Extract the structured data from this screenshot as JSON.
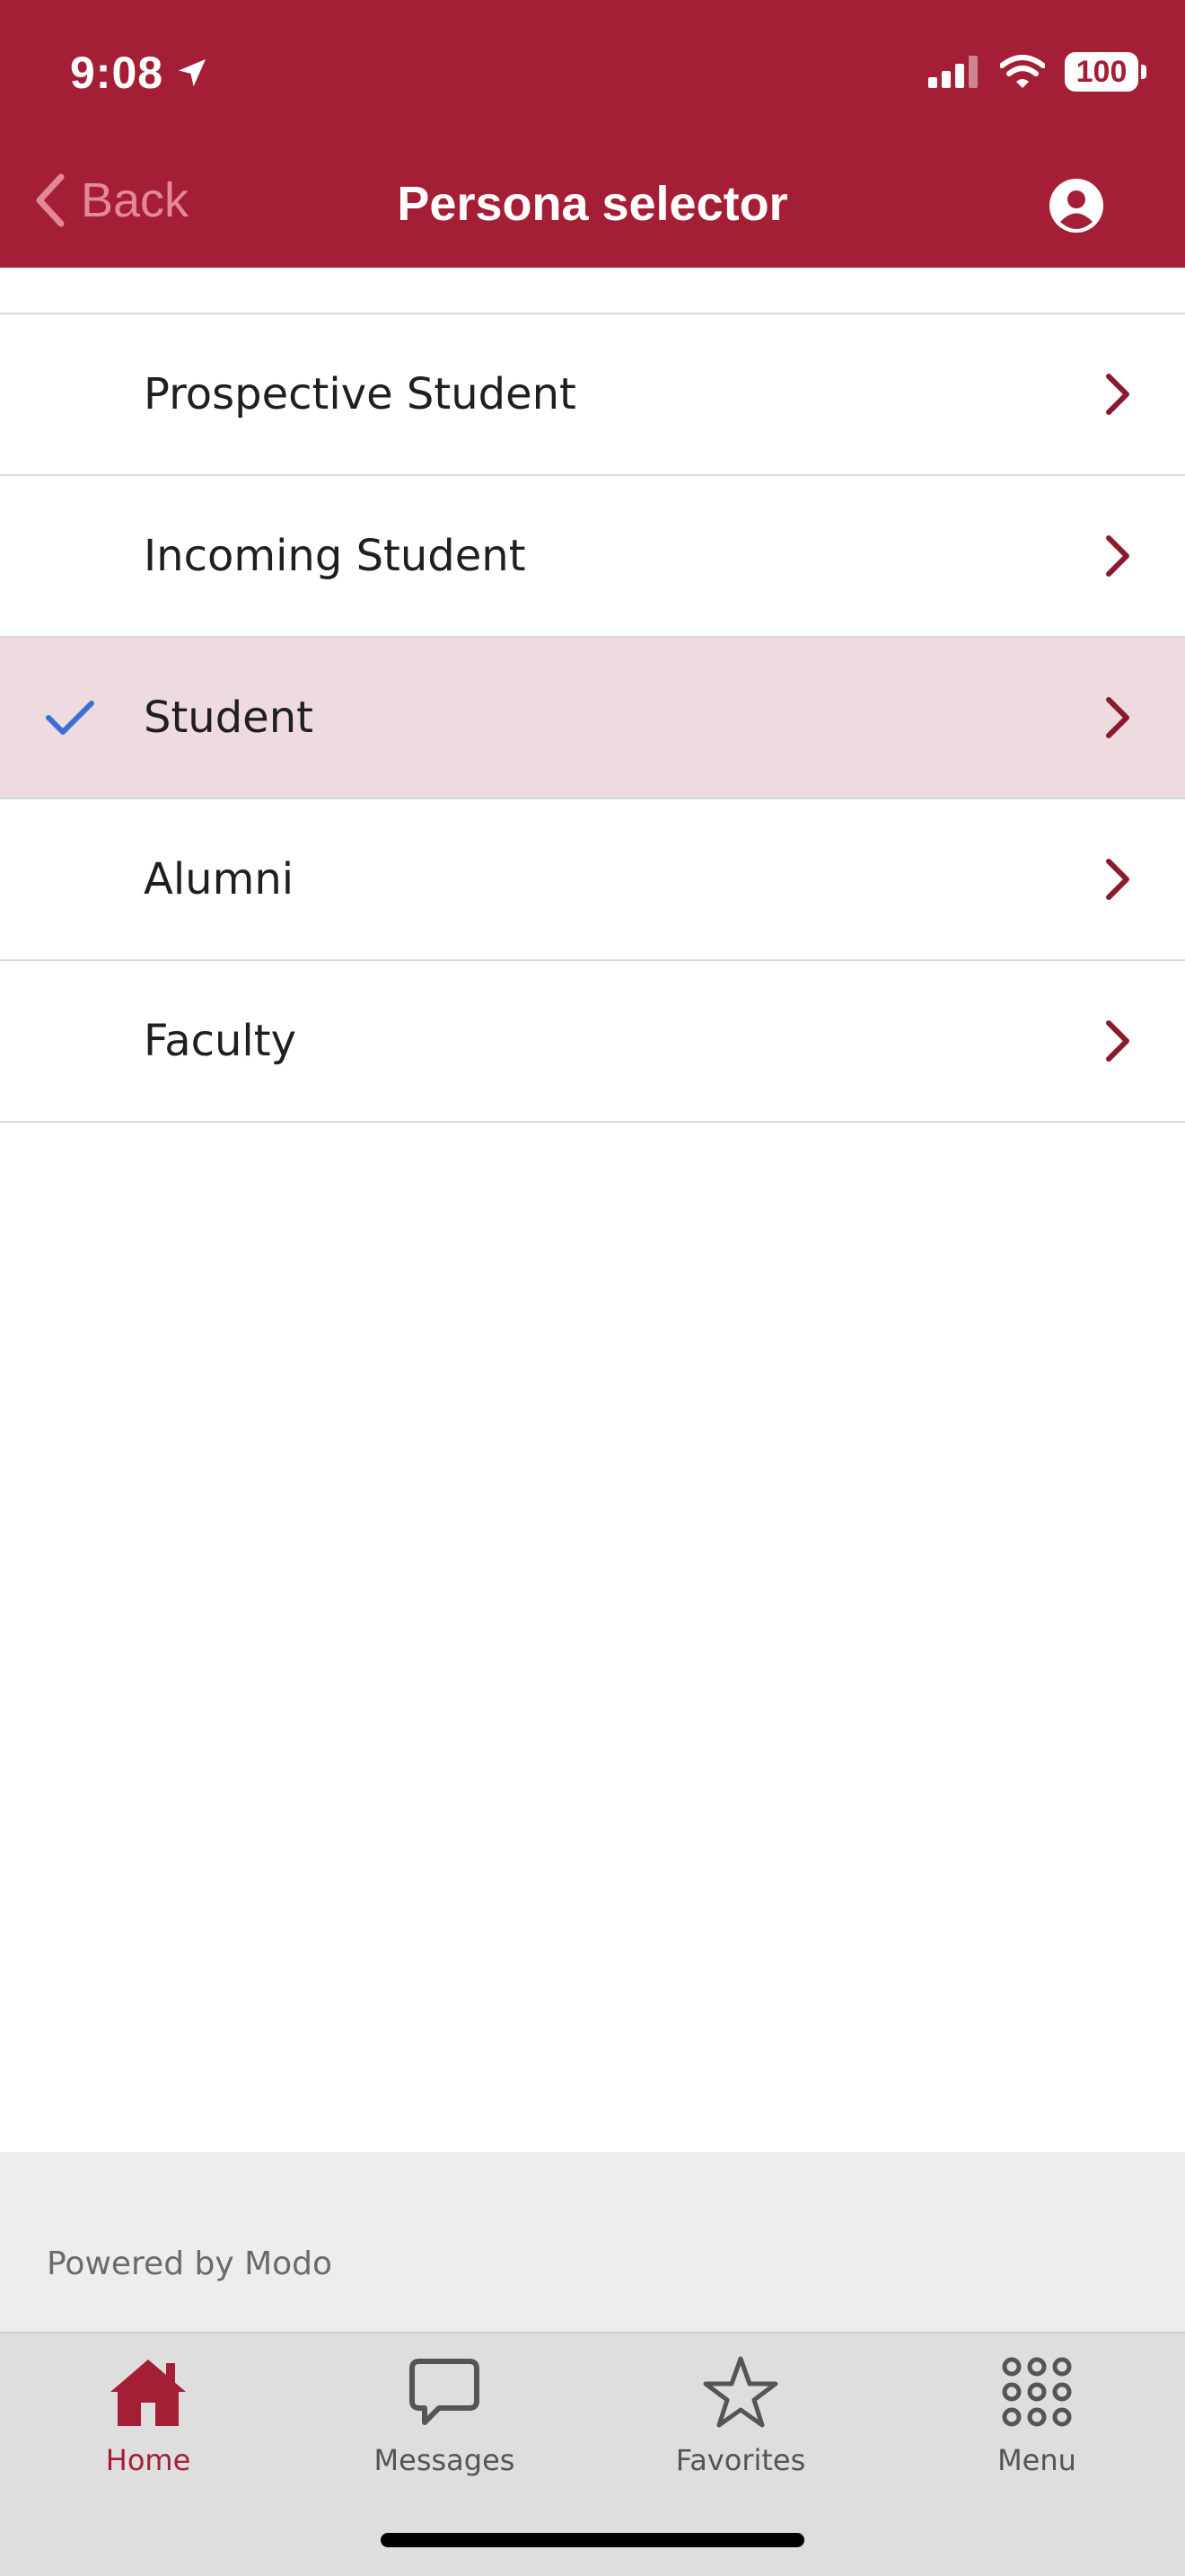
{
  "status_bar": {
    "time": "9:08",
    "battery": "100"
  },
  "nav": {
    "back_label": "Back",
    "title": "Persona selector"
  },
  "personas": [
    {
      "label": "Prospective Student",
      "selected": false
    },
    {
      "label": "Incoming Student",
      "selected": false
    },
    {
      "label": "Student",
      "selected": true
    },
    {
      "label": "Alumni",
      "selected": false
    },
    {
      "label": "Faculty",
      "selected": false
    }
  ],
  "footer": {
    "powered_by": "Powered by Modo"
  },
  "tabs": [
    {
      "label": "Home",
      "icon": "home-icon",
      "active": true
    },
    {
      "label": "Messages",
      "icon": "messages-icon",
      "active": false
    },
    {
      "label": "Favorites",
      "icon": "star-icon",
      "active": false
    },
    {
      "label": "Menu",
      "icon": "grid-icon",
      "active": false
    }
  ],
  "colors": {
    "brand": "#a41f36",
    "selected_row": "#eddbdf",
    "check": "#3a6fd8"
  }
}
